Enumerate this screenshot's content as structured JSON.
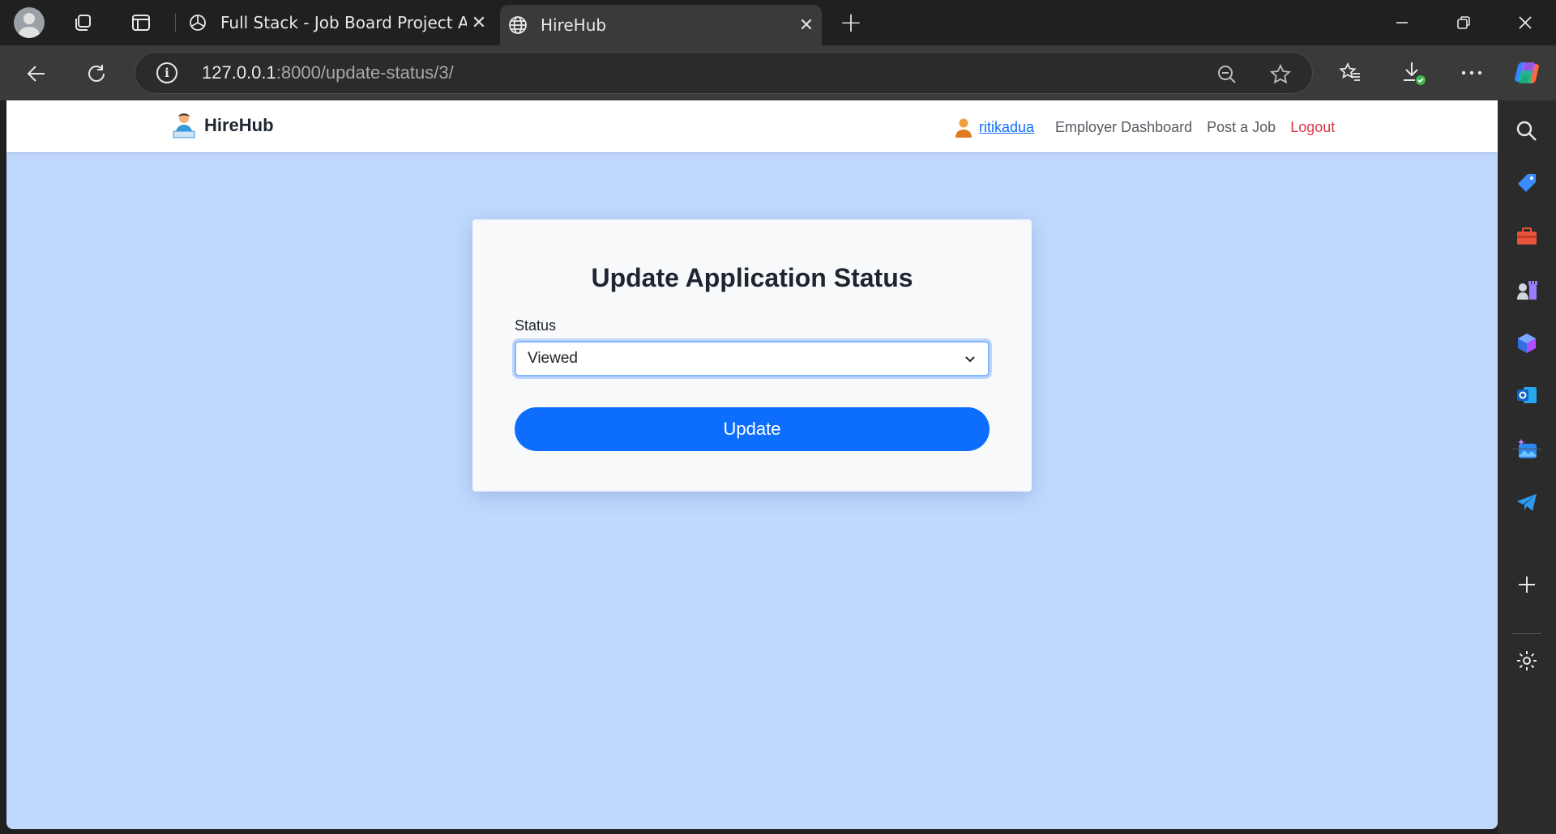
{
  "browser": {
    "tabs": [
      {
        "title": "Full Stack - Job Board Project Adv",
        "active": false,
        "favicon": "chatgpt-icon"
      },
      {
        "title": "HireHub",
        "active": true,
        "favicon": "globe-icon"
      }
    ],
    "address": {
      "host": "127.0.0.1",
      "rest": ":8000/update-status/3/"
    }
  },
  "navbar": {
    "brand": "HireHub",
    "username": "ritikadua",
    "links": {
      "dashboard": "Employer Dashboard",
      "post_job": "Post a Job",
      "logout": "Logout"
    }
  },
  "form": {
    "title": "Update Application Status",
    "status_label": "Status",
    "status_value": "Viewed",
    "submit_label": "Update"
  },
  "colors": {
    "page_bg": "#bfd8fc",
    "primary": "#0d6efd",
    "logout": "#dc3545"
  }
}
